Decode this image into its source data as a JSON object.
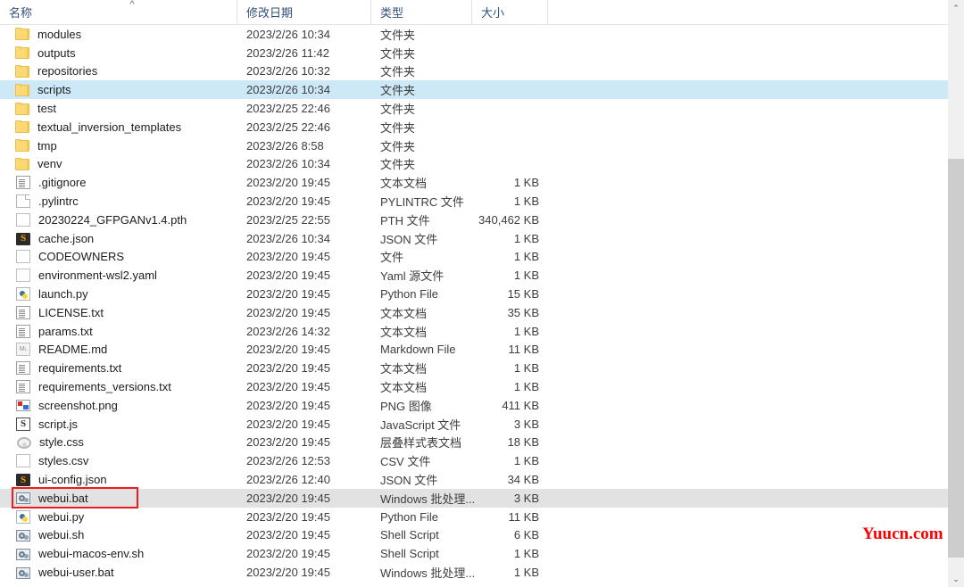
{
  "window": {
    "type": "windows-file-explorer-list"
  },
  "columns": {
    "name": "名称",
    "date": "修改日期",
    "type": "类型",
    "size": "大小",
    "sort_indicator": "^"
  },
  "files": [
    {
      "name": "modules",
      "date": "2023/2/26 10:34",
      "type": "文件夹",
      "size": "",
      "icon": "folder",
      "state": "normal"
    },
    {
      "name": "outputs",
      "date": "2023/2/26 11:42",
      "type": "文件夹",
      "size": "",
      "icon": "folder",
      "state": "normal"
    },
    {
      "name": "repositories",
      "date": "2023/2/26 10:32",
      "type": "文件夹",
      "size": "",
      "icon": "folder",
      "state": "normal"
    },
    {
      "name": "scripts",
      "date": "2023/2/26 10:34",
      "type": "文件夹",
      "size": "",
      "icon": "folder",
      "state": "selected"
    },
    {
      "name": "test",
      "date": "2023/2/25 22:46",
      "type": "文件夹",
      "size": "",
      "icon": "folder",
      "state": "normal"
    },
    {
      "name": "textual_inversion_templates",
      "date": "2023/2/25 22:46",
      "type": "文件夹",
      "size": "",
      "icon": "folder",
      "state": "normal"
    },
    {
      "name": "tmp",
      "date": "2023/2/26 8:58",
      "type": "文件夹",
      "size": "",
      "icon": "folder",
      "state": "normal"
    },
    {
      "name": "venv",
      "date": "2023/2/26 10:34",
      "type": "文件夹",
      "size": "",
      "icon": "folder",
      "state": "normal"
    },
    {
      "name": ".gitignore",
      "date": "2023/2/20 19:45",
      "type": "文本文档",
      "size": "1 KB",
      "icon": "txt",
      "state": "normal"
    },
    {
      "name": ".pylintrc",
      "date": "2023/2/20 19:45",
      "type": "PYLINTRC 文件",
      "size": "1 KB",
      "icon": "doc",
      "state": "normal"
    },
    {
      "name": "20230224_GFPGANv1.4.pth",
      "date": "2023/2/25 22:55",
      "type": "PTH 文件",
      "size": "340,462 KB",
      "icon": "pth",
      "state": "normal"
    },
    {
      "name": "cache.json",
      "date": "2023/2/26 10:34",
      "type": "JSON 文件",
      "size": "1 KB",
      "icon": "json",
      "state": "normal"
    },
    {
      "name": "CODEOWNERS",
      "date": "2023/2/20 19:45",
      "type": "文件",
      "size": "1 KB",
      "icon": "plain",
      "state": "normal"
    },
    {
      "name": "environment-wsl2.yaml",
      "date": "2023/2/20 19:45",
      "type": "Yaml 源文件",
      "size": "1 KB",
      "icon": "yaml",
      "state": "normal"
    },
    {
      "name": "launch.py",
      "date": "2023/2/20 19:45",
      "type": "Python File",
      "size": "15 KB",
      "icon": "py",
      "state": "normal"
    },
    {
      "name": "LICENSE.txt",
      "date": "2023/2/20 19:45",
      "type": "文本文档",
      "size": "35 KB",
      "icon": "txt",
      "state": "normal"
    },
    {
      "name": "params.txt",
      "date": "2023/2/26 14:32",
      "type": "文本文档",
      "size": "1 KB",
      "icon": "txt",
      "state": "normal"
    },
    {
      "name": "README.md",
      "date": "2023/2/20 19:45",
      "type": "Markdown File",
      "size": "11 KB",
      "icon": "md",
      "state": "normal"
    },
    {
      "name": "requirements.txt",
      "date": "2023/2/20 19:45",
      "type": "文本文档",
      "size": "1 KB",
      "icon": "txt",
      "state": "normal"
    },
    {
      "name": "requirements_versions.txt",
      "date": "2023/2/20 19:45",
      "type": "文本文档",
      "size": "1 KB",
      "icon": "txt",
      "state": "normal"
    },
    {
      "name": "screenshot.png",
      "date": "2023/2/20 19:45",
      "type": "PNG 图像",
      "size": "411 KB",
      "icon": "png",
      "state": "normal"
    },
    {
      "name": "script.js",
      "date": "2023/2/20 19:45",
      "type": "JavaScript 文件",
      "size": "3 KB",
      "icon": "js",
      "state": "normal"
    },
    {
      "name": "style.css",
      "date": "2023/2/20 19:45",
      "type": "层叠样式表文档",
      "size": "18 KB",
      "icon": "css",
      "state": "normal"
    },
    {
      "name": "styles.csv",
      "date": "2023/2/26 12:53",
      "type": "CSV 文件",
      "size": "1 KB",
      "icon": "plain",
      "state": "normal"
    },
    {
      "name": "ui-config.json",
      "date": "2023/2/26 12:40",
      "type": "JSON 文件",
      "size": "34 KB",
      "icon": "json",
      "state": "normal"
    },
    {
      "name": "webui.bat",
      "date": "2023/2/20 19:45",
      "type": "Windows 批处理...",
      "size": "3 KB",
      "icon": "bat",
      "state": "hover"
    },
    {
      "name": "webui.py",
      "date": "2023/2/20 19:45",
      "type": "Python File",
      "size": "11 KB",
      "icon": "py",
      "state": "normal"
    },
    {
      "name": "webui.sh",
      "date": "2023/2/20 19:45",
      "type": "Shell Script",
      "size": "6 KB",
      "icon": "bat",
      "state": "normal"
    },
    {
      "name": "webui-macos-env.sh",
      "date": "2023/2/20 19:45",
      "type": "Shell Script",
      "size": "1 KB",
      "icon": "bat",
      "state": "normal"
    },
    {
      "name": "webui-user.bat",
      "date": "2023/2/20 19:45",
      "type": "Windows 批处理...",
      "size": "1 KB",
      "icon": "bat",
      "state": "normal"
    }
  ],
  "annotation": {
    "highlight_target": "webui.bat",
    "highlight_color": "#ee1c1c"
  },
  "watermark": {
    "text": "Yuucn.com",
    "color": "#ff0000"
  },
  "scrollbar": {
    "up_arrow": "⌃",
    "down_arrow": "⌄"
  }
}
